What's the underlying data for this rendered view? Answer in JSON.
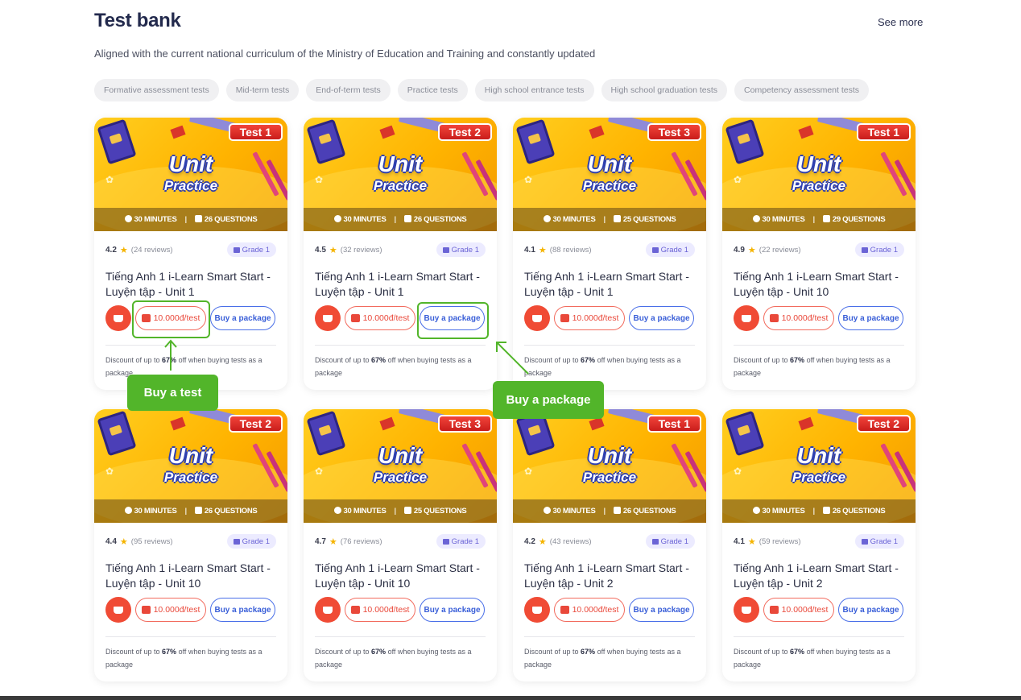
{
  "header": {
    "title": "Test bank",
    "see_more": "See more",
    "subtitle": "Aligned with the current national curriculum of the Ministry of Education and Training and constantly updated"
  },
  "filters": [
    "Formative assessment tests",
    "Mid-term tests",
    "End-of-term tests",
    "Practice tests",
    "High school entrance tests",
    "High school graduation tests",
    "Competency assessment tests"
  ],
  "thumb_text": {
    "line1": "Unit",
    "line2": "Practice"
  },
  "cards": [
    {
      "tag": "Test 1",
      "minutes": "30 MINUTES",
      "questions": "26 QUESTIONS",
      "rating": "4.2",
      "reviews": "(24 reviews)",
      "grade": "Grade 1",
      "title": "Tiếng Anh 1 i-Learn Smart Start - Luyện tập - Unit 1",
      "price": "10.000đ/test",
      "package": "Buy a package"
    },
    {
      "tag": "Test 2",
      "minutes": "30 MINUTES",
      "questions": "26 QUESTIONS",
      "rating": "4.5",
      "reviews": "(32 reviews)",
      "grade": "Grade 1",
      "title": "Tiếng Anh 1 i-Learn Smart Start - Luyện tập - Unit 1",
      "price": "10.000đ/test",
      "package": "Buy a package"
    },
    {
      "tag": "Test 3",
      "minutes": "30 MINUTES",
      "questions": "25 QUESTIONS",
      "rating": "4.1",
      "reviews": "(88 reviews)",
      "grade": "Grade 1",
      "title": "Tiếng Anh 1 i-Learn Smart Start - Luyện tập - Unit 1",
      "price": "10.000đ/test",
      "package": "Buy a package"
    },
    {
      "tag": "Test 1",
      "minutes": "30 MINUTES",
      "questions": "29 QUESTIONS",
      "rating": "4.9",
      "reviews": "(22 reviews)",
      "grade": "Grade 1",
      "title": "Tiếng Anh 1 i-Learn Smart Start - Luyện tập - Unit 10",
      "price": "10.000đ/test",
      "package": "Buy a package"
    },
    {
      "tag": "Test 2",
      "minutes": "30 MINUTES",
      "questions": "26 QUESTIONS",
      "rating": "4.4",
      "reviews": "(95 reviews)",
      "grade": "Grade 1",
      "title": "Tiếng Anh 1 i-Learn Smart Start - Luyện tập - Unit 10",
      "price": "10.000đ/test",
      "package": "Buy a package"
    },
    {
      "tag": "Test 3",
      "minutes": "30 MINUTES",
      "questions": "25 QUESTIONS",
      "rating": "4.7",
      "reviews": "(76 reviews)",
      "grade": "Grade 1",
      "title": "Tiếng Anh 1 i-Learn Smart Start - Luyện tập - Unit 10",
      "price": "10.000đ/test",
      "package": "Buy a package"
    },
    {
      "tag": "Test 1",
      "minutes": "30 MINUTES",
      "questions": "26 QUESTIONS",
      "rating": "4.2",
      "reviews": "(43 reviews)",
      "grade": "Grade 1",
      "title": "Tiếng Anh 1 i-Learn Smart Start - Luyện tập - Unit 2",
      "price": "10.000đ/test",
      "package": "Buy a package"
    },
    {
      "tag": "Test 2",
      "minutes": "30 MINUTES",
      "questions": "26 QUESTIONS",
      "rating": "4.1",
      "reviews": "(59 reviews)",
      "grade": "Grade 1",
      "title": "Tiếng Anh 1 i-Learn Smart Start - Luyện tập - Unit 2",
      "price": "10.000đ/test",
      "package": "Buy a package"
    }
  ],
  "discount": {
    "prefix": "Discount of up to ",
    "percent": "67%",
    "suffix": " off when buying tests as a package"
  },
  "annotations": {
    "buy_test": "Buy a test",
    "buy_package": "Buy a package"
  },
  "colors": {
    "accent_green": "#52b52a",
    "price_red": "#e9483a",
    "package_blue": "#3a5fd8",
    "thumb_yellow": "#ffc107"
  }
}
